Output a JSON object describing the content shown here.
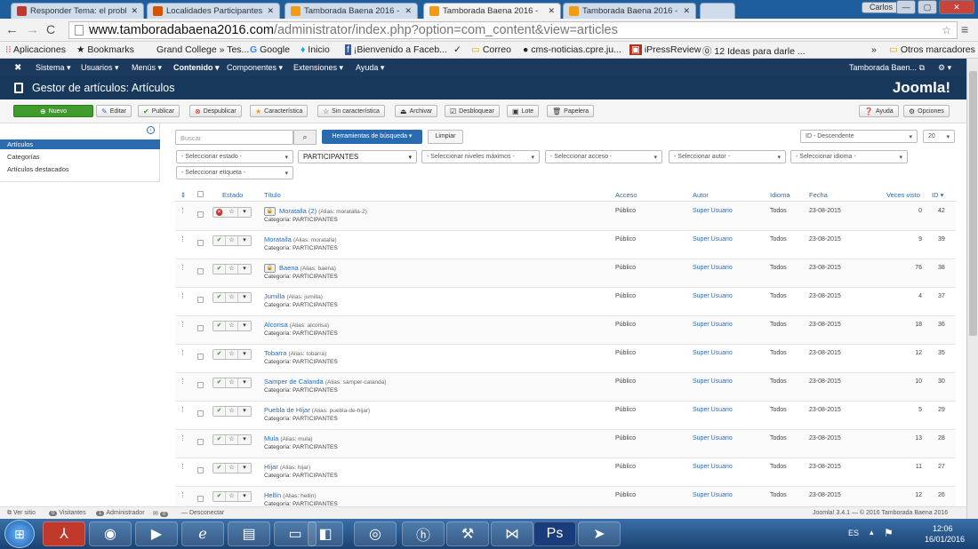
{
  "browser": {
    "tabs": [
      {
        "label": "Responder Tema: el probl",
        "color": "#c0392b"
      },
      {
        "label": "Localidades Participantes",
        "color": "#d35400"
      },
      {
        "label": "Tamborada Baena 2016 -",
        "color": "#f39c12"
      },
      {
        "label": "Tamborada Baena 2016 -",
        "color": "#f39c12"
      },
      {
        "label": "Tamborada Baena 2016 -",
        "color": "#f39c12"
      }
    ],
    "profile": "Carlos",
    "url_domain": "www.tamboradabaena2016.com",
    "url_path": "/administrator/index.php?option=com_content&view=articles",
    "bookmarks": [
      "Aplicaciones",
      "Bookmarks",
      "Grand College » Tes...",
      "Google",
      "Inicio",
      "¡Bienvenido a Faceb...",
      "Correo",
      "cms-noticias.cpre.ju...",
      "iPressReview",
      "12 Ideas para darle ...",
      "Otros marcadores"
    ]
  },
  "jnav": {
    "items": [
      "Sistema",
      "Usuarios",
      "Menús",
      "Contenido",
      "Componentes",
      "Extensiones",
      "Ayuda"
    ],
    "site": "Tamborada Baen..."
  },
  "page": {
    "title": "Gestor de artículos: Artículos",
    "logo": "Joomla!"
  },
  "toolbar": {
    "new": "Nuevo",
    "edit": "Editar",
    "publish": "Publicar",
    "unpublish": "Despublicar",
    "feature": "Característica",
    "unfeature": "Sin característica",
    "archive": "Archivar",
    "checkin": "Desbloquear",
    "batch": "Lote",
    "trash": "Papelera",
    "help": "Ayuda",
    "options": "Opciones"
  },
  "sidebar": {
    "items": [
      "Artículos",
      "Categorías",
      "Artículos destacados"
    ]
  },
  "filters": {
    "search_placeholder": "Buscar",
    "search_tools": "Herramientas de búsqueda ▾",
    "clear": "Limpiar",
    "sort": "ID - Descendente",
    "limit": "20",
    "state": "- Seleccionar estado -",
    "category": "PARTICIPANTES",
    "level": "- Seleccionar niveles máximos -",
    "access": "- Seleccionar acceso -",
    "author": "- Seleccionar autor -",
    "language": "- Seleccionar idioma -",
    "tag": "- Seleccionar etiqueta -"
  },
  "table": {
    "headers": {
      "estado": "Estado",
      "titulo": "Título",
      "acceso": "Acceso",
      "autor": "Autor",
      "idioma": "Idioma",
      "fecha": "Fecha",
      "visto": "Veces visto",
      "id": "ID ▾"
    },
    "category_prefix": "Categoría: PARTICIPANTES",
    "rows": [
      {
        "title": "Moratalla (2)",
        "alias": "(Alias: moratalla-2)",
        "locked": true,
        "published": false,
        "access": "Público",
        "author": "Super Usuario",
        "lang": "Todos",
        "date": "23-08-2015",
        "hits": "0",
        "id": "42"
      },
      {
        "title": "Moratalla",
        "alias": "(Alias: moratalla)",
        "locked": false,
        "published": true,
        "access": "Público",
        "author": "Super Usuario",
        "lang": "Todos",
        "date": "23-08-2015",
        "hits": "9",
        "id": "39"
      },
      {
        "title": "Baena",
        "alias": "(Alias: baena)",
        "locked": true,
        "published": true,
        "access": "Público",
        "author": "Super Usuario",
        "lang": "Todos",
        "date": "23-08-2015",
        "hits": "76",
        "id": "38"
      },
      {
        "title": "Jumilla",
        "alias": "(Alias: jumilla)",
        "locked": false,
        "published": true,
        "access": "Público",
        "author": "Super Usuario",
        "lang": "Todos",
        "date": "23-08-2015",
        "hits": "4",
        "id": "37"
      },
      {
        "title": "Alcorisa",
        "alias": "(Alias: alcorisa)",
        "locked": false,
        "published": true,
        "access": "Público",
        "author": "Super Usuario",
        "lang": "Todos",
        "date": "23-08-2015",
        "hits": "18",
        "id": "36"
      },
      {
        "title": "Tobarra",
        "alias": "(Alias: tobarra)",
        "locked": false,
        "published": true,
        "access": "Público",
        "author": "Super Usuario",
        "lang": "Todos",
        "date": "23-08-2015",
        "hits": "12",
        "id": "35"
      },
      {
        "title": "Samper de Calanda",
        "alias": "(Alias: samper-calanda)",
        "locked": false,
        "published": true,
        "access": "Público",
        "author": "Super Usuario",
        "lang": "Todos",
        "date": "23-08-2015",
        "hits": "10",
        "id": "30"
      },
      {
        "title": "Puebla de Híjar",
        "alias": "(Alias: puebla-de-hijar)",
        "locked": false,
        "published": true,
        "access": "Público",
        "author": "Super Usuario",
        "lang": "Todos",
        "date": "23-08-2015",
        "hits": "5",
        "id": "29"
      },
      {
        "title": "Mula",
        "alias": "(Alias: mula)",
        "locked": false,
        "published": true,
        "access": "Público",
        "author": "Super Usuario",
        "lang": "Todos",
        "date": "23-08-2015",
        "hits": "13",
        "id": "28"
      },
      {
        "title": "Híjar",
        "alias": "(Alias: hijar)",
        "locked": false,
        "published": true,
        "access": "Público",
        "author": "Super Usuario",
        "lang": "Todos",
        "date": "23-08-2015",
        "hits": "11",
        "id": "27"
      },
      {
        "title": "Hellín",
        "alias": "(Alias: hellin)",
        "locked": false,
        "published": true,
        "access": "Público",
        "author": "Super Usuario",
        "lang": "Todos",
        "date": "23-08-2015",
        "hits": "12",
        "id": "26"
      }
    ]
  },
  "status": {
    "view_site": "Ver sitio",
    "visitors_count": "0",
    "visitors": "Visitantes",
    "admins_count": "1",
    "admins": "Administrador",
    "messages_count": "0",
    "logout": "Desconectar",
    "footer": "Joomla! 3.4.1 — © 2016 Tamborada Baena 2016"
  },
  "tray": {
    "lang": "ES",
    "time": "12:06",
    "date": "16/01/2016"
  }
}
